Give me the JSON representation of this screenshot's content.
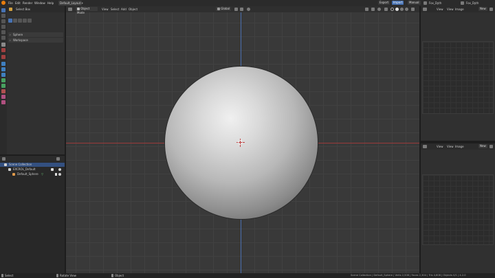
{
  "menu": [
    "File",
    "Edit",
    "Render",
    "Window",
    "Help"
  ],
  "workspace_tab": "Default_Layout",
  "top_right": {
    "export_label": "Export",
    "import_label": "Import",
    "manual_label": "Manual",
    "scene_name": "Fox_Dyth",
    "view_layer": "Fox_Dyth"
  },
  "left_panel": {
    "tool_label": "Select Box",
    "sections": [
      "Sphere",
      "Workspace"
    ]
  },
  "viewport": {
    "mode": "Object Mode",
    "menus": [
      "View",
      "Select",
      "Add",
      "Object"
    ],
    "orientation": "Global"
  },
  "outliner": {
    "rows": [
      {
        "label": "Scene Collection"
      },
      {
        "label": "EXCROL_Default"
      },
      {
        "label": "Default_Sphere"
      }
    ]
  },
  "right_panels": {
    "top": {
      "menus": [
        "View",
        "View",
        "Image"
      ],
      "new_label": "New"
    },
    "bottom": {
      "menus": [
        "View",
        "View",
        "Image"
      ],
      "new_label": "New"
    }
  },
  "status": {
    "left_items": [
      "Select",
      "Rotate View",
      "Object"
    ],
    "right_text": "Scene Collection | Default_Sphere | Verts 2,506 | Faces 2,304 | Tris 4,608 | Objects 0/1 | 4.2.0"
  },
  "colors": {
    "accent": "#4772b3",
    "x_axis": "#9b3a3a",
    "y_axis": "#4a6fb0"
  }
}
